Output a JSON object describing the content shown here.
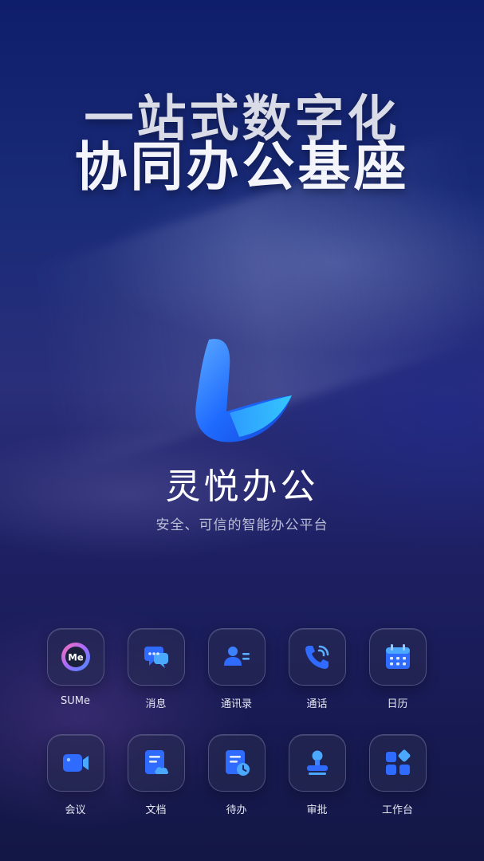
{
  "hero": {
    "line1": "一站式数字化",
    "line2": "协同办公基座"
  },
  "brand": {
    "app_name": "灵悦办公",
    "tagline": "安全、可信的智能办公平台",
    "accent": "#2f6bff"
  },
  "features": [
    {
      "label": "SUMe",
      "icon": "sume-icon"
    },
    {
      "label": "消息",
      "icon": "message-icon"
    },
    {
      "label": "通讯录",
      "icon": "contacts-icon"
    },
    {
      "label": "通话",
      "icon": "call-icon"
    },
    {
      "label": "日历",
      "icon": "calendar-icon"
    },
    {
      "label": "会议",
      "icon": "meeting-icon"
    },
    {
      "label": "文档",
      "icon": "document-icon"
    },
    {
      "label": "待办",
      "icon": "todo-icon"
    },
    {
      "label": "审批",
      "icon": "approval-icon"
    },
    {
      "label": "工作台",
      "icon": "workbench-icon"
    }
  ],
  "me_badge": "Me"
}
